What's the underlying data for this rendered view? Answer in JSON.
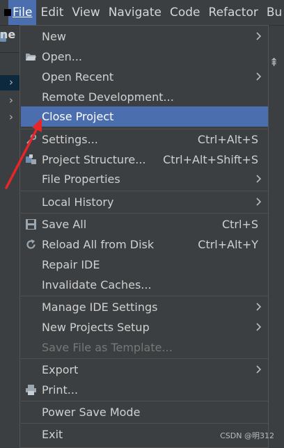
{
  "menubar": {
    "items": [
      {
        "label": "File",
        "active": true
      },
      {
        "label": "Edit"
      },
      {
        "label": "View"
      },
      {
        "label": "Navigate"
      },
      {
        "label": "Code"
      },
      {
        "label": "Refactor"
      },
      {
        "label": "Bu"
      }
    ]
  },
  "background": {
    "project_name": "ne"
  },
  "file_menu": {
    "items": [
      {
        "label": "New",
        "submenu": true
      },
      {
        "label": "Open...",
        "icon": "folder-icon"
      },
      {
        "label": "Open Recent",
        "submenu": true
      },
      {
        "label": "Remote Development..."
      },
      {
        "label": "Close Project",
        "highlighted": true
      },
      {
        "label": "Settings...",
        "shortcut": "Ctrl+Alt+S",
        "icon": "wrench-icon"
      },
      {
        "label": "Project Structure...",
        "shortcut": "Ctrl+Alt+Shift+S",
        "icon": "project-structure-icon"
      },
      {
        "label": "File Properties",
        "submenu": true
      },
      {
        "label": "Local History",
        "submenu": true
      },
      {
        "label": "Save All",
        "shortcut": "Ctrl+S",
        "icon": "save-icon"
      },
      {
        "label": "Reload All from Disk",
        "shortcut": "Ctrl+Alt+Y",
        "icon": "reload-icon"
      },
      {
        "label": "Repair IDE"
      },
      {
        "label": "Invalidate Caches..."
      },
      {
        "label": "Manage IDE Settings",
        "submenu": true
      },
      {
        "label": "New Projects Setup",
        "submenu": true
      },
      {
        "label": "Save File as Template...",
        "disabled": true
      },
      {
        "label": "Export",
        "submenu": true
      },
      {
        "label": "Print...",
        "icon": "printer-icon"
      },
      {
        "label": "Power Save Mode"
      },
      {
        "label": "Exit"
      }
    ]
  },
  "annotation": {
    "arrow_color": "#e8262a"
  },
  "watermark": "CSDN @明312",
  "colors": {
    "highlight": "#4b6eaf",
    "menu_bg": "#3c3f41",
    "text": "#d0d0d0",
    "disabled_text": "#777777"
  }
}
